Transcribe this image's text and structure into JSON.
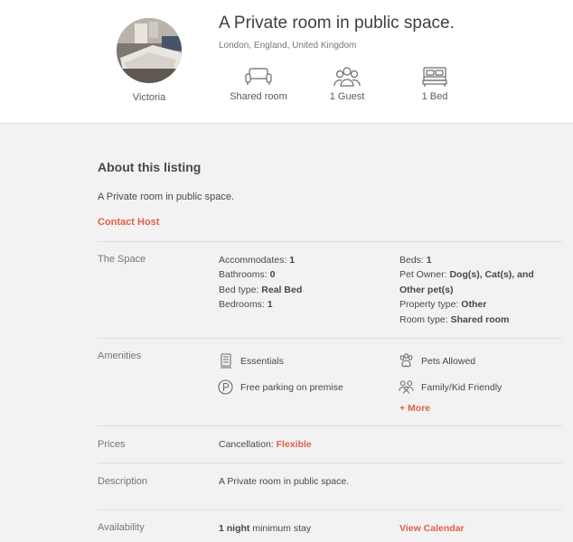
{
  "listing": {
    "title": "A Private room in public space.",
    "location": "London, England, United Kingdom",
    "host_name": "Victoria"
  },
  "stats": [
    {
      "icon": "sofa-icon",
      "label": "Shared room"
    },
    {
      "icon": "guests-icon",
      "label": "1 Guest"
    },
    {
      "icon": "bed-icon",
      "label": "1 Bed"
    }
  ],
  "about": {
    "heading": "About this listing",
    "summary": "A Private room in public space.",
    "contact_label": "Contact Host"
  },
  "space": {
    "label": "The Space",
    "accommodates_label": "Accommodates:",
    "accommodates_value": "1",
    "bathrooms_label": "Bathrooms:",
    "bathrooms_value": "0",
    "bed_type_label": "Bed type:",
    "bed_type_value": "Real Bed",
    "bedrooms_label": "Bedrooms:",
    "bedrooms_value": "1",
    "beds_label": "Beds:",
    "beds_value": "1",
    "pet_owner_label": "Pet Owner:",
    "pet_owner_value_line1": "Dog(s), Cat(s), and",
    "pet_owner_value_line2": "Other pet(s)",
    "property_type_label": "Property type:",
    "property_type_value": "Other",
    "room_type_label": "Room type:",
    "room_type_value": "Shared room"
  },
  "amenities": {
    "label": "Amenities",
    "items": [
      {
        "icon": "essentials-icon",
        "label": "Essentials"
      },
      {
        "icon": "pets-icon",
        "label": "Pets Allowed"
      },
      {
        "icon": "parking-icon",
        "label": "Free parking on premise"
      },
      {
        "icon": "family-icon",
        "label": "Family/Kid Friendly"
      }
    ],
    "more_label": "+ More"
  },
  "prices": {
    "label": "Prices",
    "cancellation_label": "Cancellation:",
    "cancellation_value": "Flexible"
  },
  "description": {
    "label": "Description",
    "text": "A Private room in public space."
  },
  "availability": {
    "label": "Availability",
    "min_nights": "1 night",
    "min_stay_suffix": "minimum stay",
    "calendar_link": "View Calendar"
  },
  "colors": {
    "accent": "#e06149",
    "text": "#484848",
    "muted": "#767676",
    "background": "#f2f2f2"
  }
}
